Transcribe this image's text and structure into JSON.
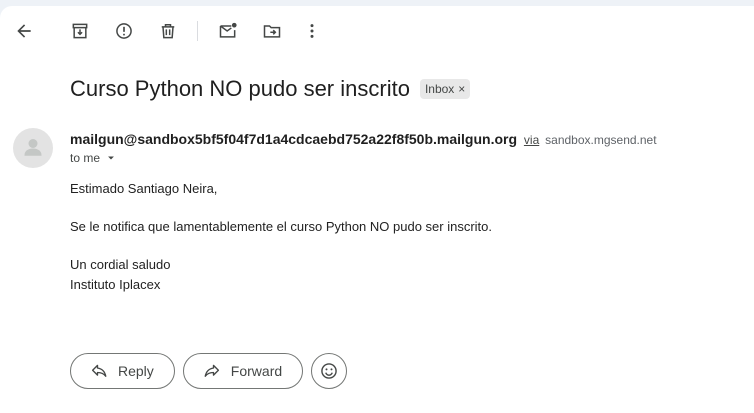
{
  "toolbar": {
    "icons": [
      "back-arrow-icon",
      "archive-icon",
      "report-spam-icon",
      "delete-icon",
      "mark-unread-icon",
      "move-to-icon",
      "more-options-icon"
    ]
  },
  "email": {
    "subject": "Curso Python NO pudo ser inscrito",
    "label": "Inbox",
    "label_remove": "×",
    "sender": "mailgun@sandbox5bf5f04f7d1a4cdcaebd752a22f8f50b.mailgun.org",
    "via_label": "via",
    "via_domain": "sandbox.mgsend.net",
    "recipient": "to me",
    "body": {
      "greeting": "Estimado Santiago Neira,",
      "message": "Se le notifica que lamentablemente el curso Python NO pudo ser inscrito.",
      "closing": "Un cordial saludo",
      "signature": "Instituto Iplacex"
    }
  },
  "actions": {
    "reply_label": "Reply",
    "forward_label": "Forward"
  }
}
